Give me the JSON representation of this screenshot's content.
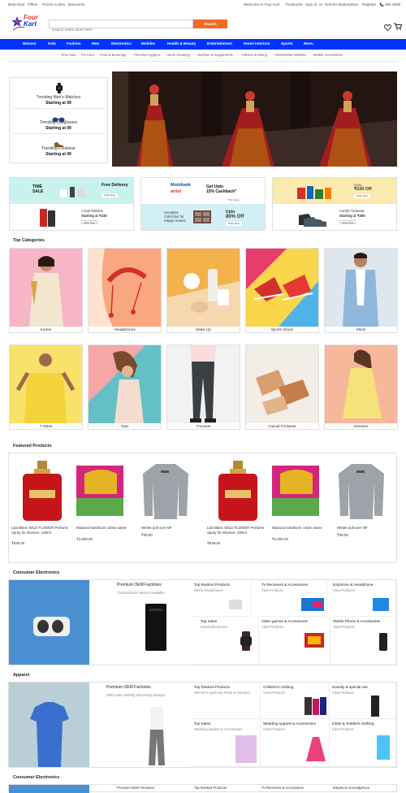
{
  "topbar": {
    "left": [
      "Best Deal",
      "Offers",
      "Promo Codes",
      "Discounts"
    ],
    "right": [
      "Welcome to Four Kart",
      "Trackorder",
      "Sign In",
      "or",
      "Sell On Marketplace",
      "Register",
      "080 0000"
    ]
  },
  "logo": {
    "line1": "Four",
    "line2": "Kart"
  },
  "search": {
    "placeholder": "Search entire store here...",
    "button": "Search"
  },
  "nav": [
    "Women",
    "Kids",
    "Fashion",
    "Men",
    "Electronics",
    "Mobiles",
    "Health & Beauty",
    "Entertainment",
    "Home Interiors",
    "Sports",
    "More.."
  ],
  "subnav": [
    "Time Sale",
    "Flu Care",
    "Food & Beverage",
    "Personal Hygiene",
    "Home Cleaning",
    "Nutrition & Suppliments",
    "Kitchen & Dining",
    "Refurbished Mobiles",
    "Mobile Accessories"
  ],
  "trending": [
    {
      "title": "Trending Men's Watches",
      "price": "Starting at 99"
    },
    {
      "title": "Trending Sunglasses",
      "price": "Starting at 99"
    },
    {
      "title": "Trending Footwear",
      "price": "Starting at 99"
    }
  ],
  "promo": {
    "a": {
      "t1": "TIME",
      "t2": "SALE",
      "tag": "Free Delivery",
      "btn": "Shop Now",
      "m1": "1 Kart Mobiles",
      "m2": "Starting at ₹449",
      "btn2": "Shop Now"
    },
    "b": {
      "brand": "Mobikwik",
      "l1": "Get Upto",
      "l2": "15% Cashback*",
      "tc": "*T&C Apply",
      "airtel": "airtel",
      "c1": "Complete",
      "c2": "Collection for",
      "c3": "Happy Homes",
      "u1": "Upto",
      "u2": "80% Off",
      "btn": "Shop Now"
    },
    "c": {
      "e1": "Extra",
      "e2": "₹100 Off",
      "btn": "Shop Now",
      "f1": "Comfy Footwear",
      "f2": "Starting at ₹369",
      "btn2": "Shop Now"
    }
  },
  "top_categories": {
    "title": "Top Categories",
    "items": [
      "Kurtas",
      "Headphones",
      "Make Up",
      "Sports Shoes",
      "Shirts",
      "T Shirts",
      "Tops",
      "Trousers",
      "Casual Footwear",
      "Dresses"
    ]
  },
  "featured": {
    "title": "Featured Products",
    "items": [
      {
        "name": "Lyla Blanc WILD FLOWER Perfume Spray for Women- 100ml",
        "price": "₹639.00"
      },
      {
        "name": "Madurai handloom cotton saree",
        "price": "₹4,000.00"
      },
      {
        "name": "Winter pull over NF",
        "price": "₹39.00"
      },
      {
        "name": "Lyla Blanc WILD FLOWER Perfume Spray for Women- 100ml",
        "price": "₹639.00"
      },
      {
        "name": "Madurai handloom cotton saree",
        "price": "₹4,000.00"
      },
      {
        "name": "Winter pull over NF",
        "price": "₹39.00"
      }
    ]
  },
  "electronics": {
    "title": "Consumer Electronics",
    "feature": {
      "h": "Premium OEM Factories",
      "s": "Customization service available"
    },
    "cells": [
      {
        "h": "Top Ranked Products",
        "s": "Wired Headphones"
      },
      {
        "h": "Tv Recievers & Accessories",
        "s": "View Products"
      },
      {
        "h": "Earphone & Headphone",
        "s": "View Products"
      },
      {
        "h": "Top Sales",
        "s": "Smart Electronics"
      },
      {
        "h": "Video games & Accessories",
        "s": "View Products"
      },
      {
        "h": "Mobile Phone & Accessories",
        "s": "View Products"
      }
    ]
  },
  "apparel": {
    "title": "Apparel",
    "feature": {
      "h": "Premium OEM Factories",
      "s": "Well made clothing with trendy designs"
    },
    "cells": [
      {
        "h": "Top Ranked Products",
        "s": "Women's quick-dry Pants & Trousers"
      },
      {
        "h": "Children's clothing",
        "s": "View Products"
      },
      {
        "h": "Novelty & special use",
        "s": "View Products"
      },
      {
        "h": "Top Sales",
        "s": "Wedding Apparel & Accessories"
      },
      {
        "h": "Wedding Apparel & Accessories",
        "s": "View Products"
      },
      {
        "h": "Infant & Toddlers clothing",
        "s": "View Products"
      }
    ]
  },
  "electronics2": {
    "title": "Consumer Electronics",
    "feature": {
      "h": "Premium OEM Factories"
    },
    "cells": [
      {
        "h": "Top Ranked Products"
      },
      {
        "h": "Tv Recievers & Accessories"
      },
      {
        "h": "Earphone & Headphone"
      }
    ]
  }
}
